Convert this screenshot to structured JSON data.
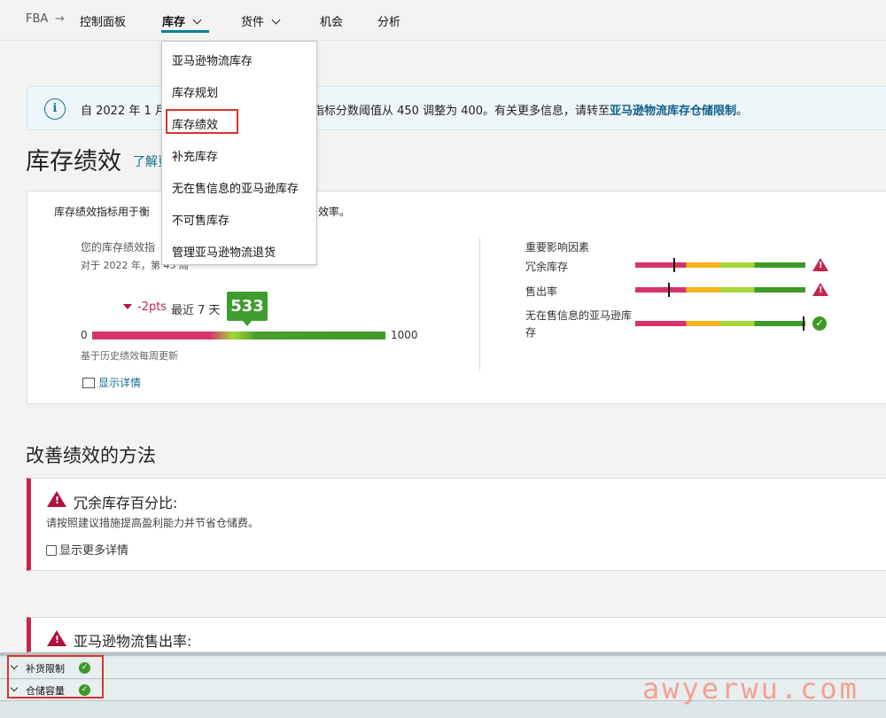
{
  "nav": {
    "fba": "FBA",
    "arrow": "→",
    "items": [
      {
        "label": "控制面板"
      },
      {
        "label": "库存"
      },
      {
        "label": "货件"
      },
      {
        "label": "机会"
      },
      {
        "label": "分析"
      }
    ]
  },
  "dropdown": {
    "items": [
      {
        "label": "亚马逊物流库存"
      },
      {
        "label": "库存规划"
      },
      {
        "label": "库存绩效"
      },
      {
        "label": "补充库存"
      },
      {
        "label": "无在售信息的亚马逊库存"
      },
      {
        "label": "不可售库存"
      },
      {
        "label": "管理亚马逊物流退货"
      }
    ]
  },
  "banner": {
    "icon": "info-icon",
    "icon_glyph": "i",
    "text_before": "自 2022 年 1 月",
    "text_after": "指标分数阈值从 450 调整为 400。有关更多信息，请转至",
    "link": "亚马逊物流库存仓储限制",
    "text_end": "。"
  },
  "page": {
    "title": "库存绩效",
    "learn_more": "了解更"
  },
  "performance": {
    "desc_left": "库存绩效指标用于衡",
    "desc_right": "效率。",
    "ipi_title": "您的库存绩效指",
    "ipi_sub": "对于 2022 年，第 45 周",
    "delta": "-2pts",
    "period": "最近 7 天",
    "score": 533,
    "scale_min": "0",
    "scale_max": "1000",
    "update_note": "基于历史绩效每周更新",
    "show_detail": "显示详情",
    "factors_title": "重要影响因素",
    "factors": [
      {
        "label": "冗余库存",
        "marker": 0.23,
        "status": "warning"
      },
      {
        "label": "售出率",
        "marker": 0.2,
        "status": "warning"
      },
      {
        "label": "无在售信息的亚马逊库存",
        "marker": 0.99,
        "status": "ok"
      }
    ]
  },
  "methods": {
    "title": "改善绩效的方法",
    "cards": [
      {
        "title": "冗余库存百分比:",
        "desc": "请按照建议措施提高盈利能力并节省仓储费。",
        "checkbox": "显示更多详情"
      },
      {
        "title": "亚马逊物流售出率:"
      }
    ]
  },
  "bottom": {
    "rows": [
      {
        "label": "补货限制",
        "status": "ok"
      },
      {
        "label": "仓储容量",
        "status": "ok"
      }
    ]
  },
  "watermark": "awyerwu.com",
  "colors": {
    "accent": "#008296",
    "alert": "#c7254e",
    "success": "#3e9a28",
    "highlight_box": "#d9342b"
  }
}
